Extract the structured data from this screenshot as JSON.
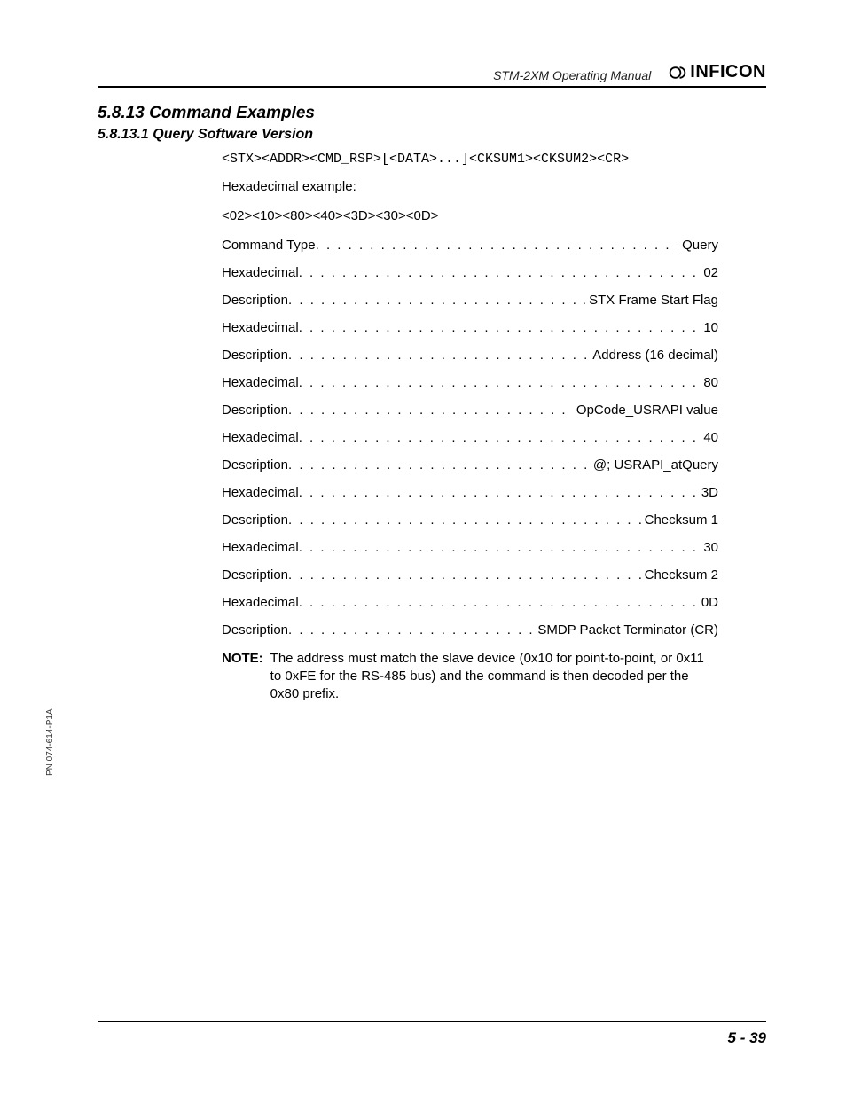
{
  "header": {
    "manual_title": "STM-2XM Operating Manual",
    "brand": "INFICON"
  },
  "section": {
    "number_title": "5.8.13  Command Examples",
    "sub_number_title": "5.8.13.1  Query Software Version"
  },
  "body": {
    "format_line": "<STX><ADDR><CMD_RSP>[<DATA>...]<CKSUM1><CKSUM2><CR>",
    "hex_example_label": "Hexadecimal example:",
    "hex_example": "<02><10><80><40><3D><30><0D>",
    "pairs": [
      {
        "k": "Command Type",
        "v": "Query"
      },
      {
        "k": "Hexadecimal",
        "v": "02"
      },
      {
        "k": "Description",
        "v": "STX Frame Start Flag"
      },
      {
        "k": "Hexadecimal",
        "v": "10"
      },
      {
        "k": "Description",
        "v": "Address (16 decimal)"
      },
      {
        "k": "Hexadecimal",
        "v": "80"
      },
      {
        "k": "Description",
        "v": "OpCode_USRAPI value"
      },
      {
        "k": "Hexadecimal",
        "v": "40"
      },
      {
        "k": "Description",
        "v": "@; USRAPI_atQuery"
      },
      {
        "k": "Hexadecimal",
        "v": "3D"
      },
      {
        "k": "Description",
        "v": "Checksum 1"
      },
      {
        "k": "Hexadecimal",
        "v": "30"
      },
      {
        "k": "Description",
        "v": "Checksum 2"
      },
      {
        "k": "Hexadecimal",
        "v": "0D"
      },
      {
        "k": "Description",
        "v": "SMDP Packet Terminator (CR)"
      }
    ],
    "note_label": "NOTE:",
    "note_text": "The address must match the slave device (0x10 for point-to-point, or 0x11 to 0xFE for the RS-485 bus) and the command is then decoded per the 0x80 prefix."
  },
  "side_pn": "PN 074-614-P1A",
  "footer": {
    "page": "5 - 39"
  },
  "dots_fill": ". . . . . . . . . . . . . . . . . . . . . . . . . . . . . . . . . . . . . . . ."
}
